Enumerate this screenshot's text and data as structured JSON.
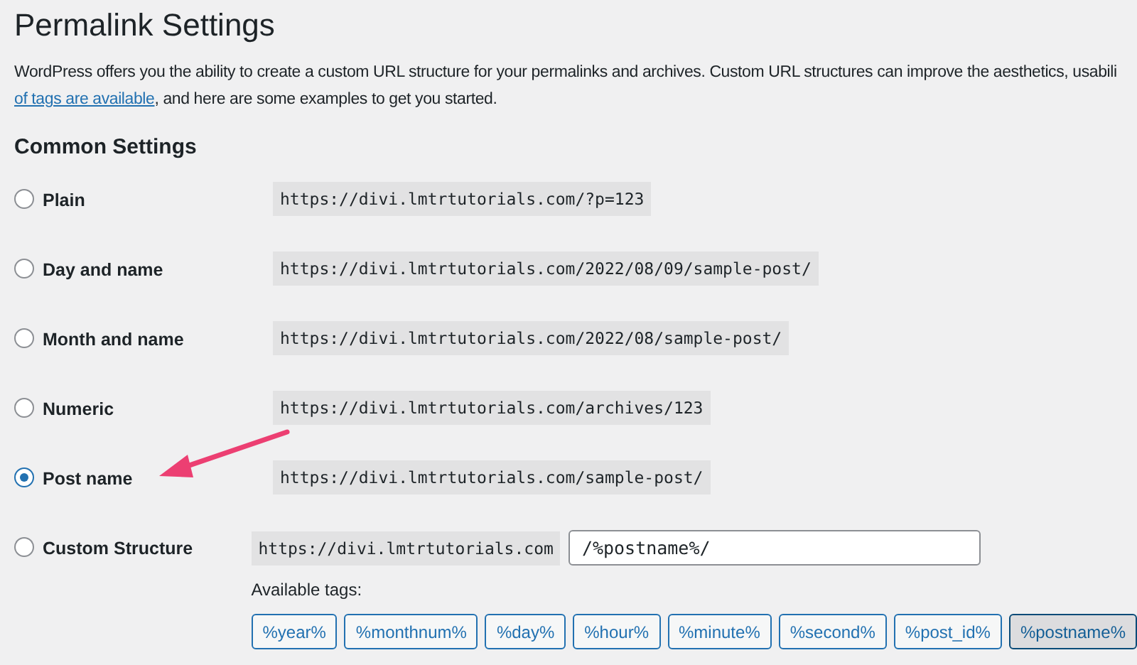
{
  "title": "Permalink Settings",
  "intro": {
    "line_1": "WordPress offers you the ability to create a custom URL structure for your permalinks and archives. Custom URL structures can improve the aesthetics, usabili",
    "link": "of tags are available",
    "rest": ", and here are some examples to get you started."
  },
  "section_title": "Common Settings",
  "options": [
    {
      "label": "Plain",
      "example": "https://divi.lmtrtutorials.com/?p=123",
      "selected": false,
      "kind": "preset"
    },
    {
      "label": "Day and name",
      "example": "https://divi.lmtrtutorials.com/2022/08/09/sample-post/",
      "selected": false,
      "kind": "preset"
    },
    {
      "label": "Month and name",
      "example": "https://divi.lmtrtutorials.com/2022/08/sample-post/",
      "selected": false,
      "kind": "preset"
    },
    {
      "label": "Numeric",
      "example": "https://divi.lmtrtutorials.com/archives/123",
      "selected": false,
      "kind": "preset"
    },
    {
      "label": "Post name",
      "example": "https://divi.lmtrtutorials.com/sample-post/",
      "selected": true,
      "kind": "preset"
    },
    {
      "label": "Custom Structure",
      "example": "https://divi.lmtrtutorials.com",
      "selected": false,
      "kind": "custom",
      "value": "/%postname%/"
    }
  ],
  "tags_label": "Available tags:",
  "tags": [
    {
      "label": "%year%",
      "selected": false
    },
    {
      "label": "%monthnum%",
      "selected": false
    },
    {
      "label": "%day%",
      "selected": false
    },
    {
      "label": "%hour%",
      "selected": false
    },
    {
      "label": "%minute%",
      "selected": false
    },
    {
      "label": "%second%",
      "selected": false
    },
    {
      "label": "%post_id%",
      "selected": false
    },
    {
      "label": "%postname%",
      "selected": true
    }
  ]
}
